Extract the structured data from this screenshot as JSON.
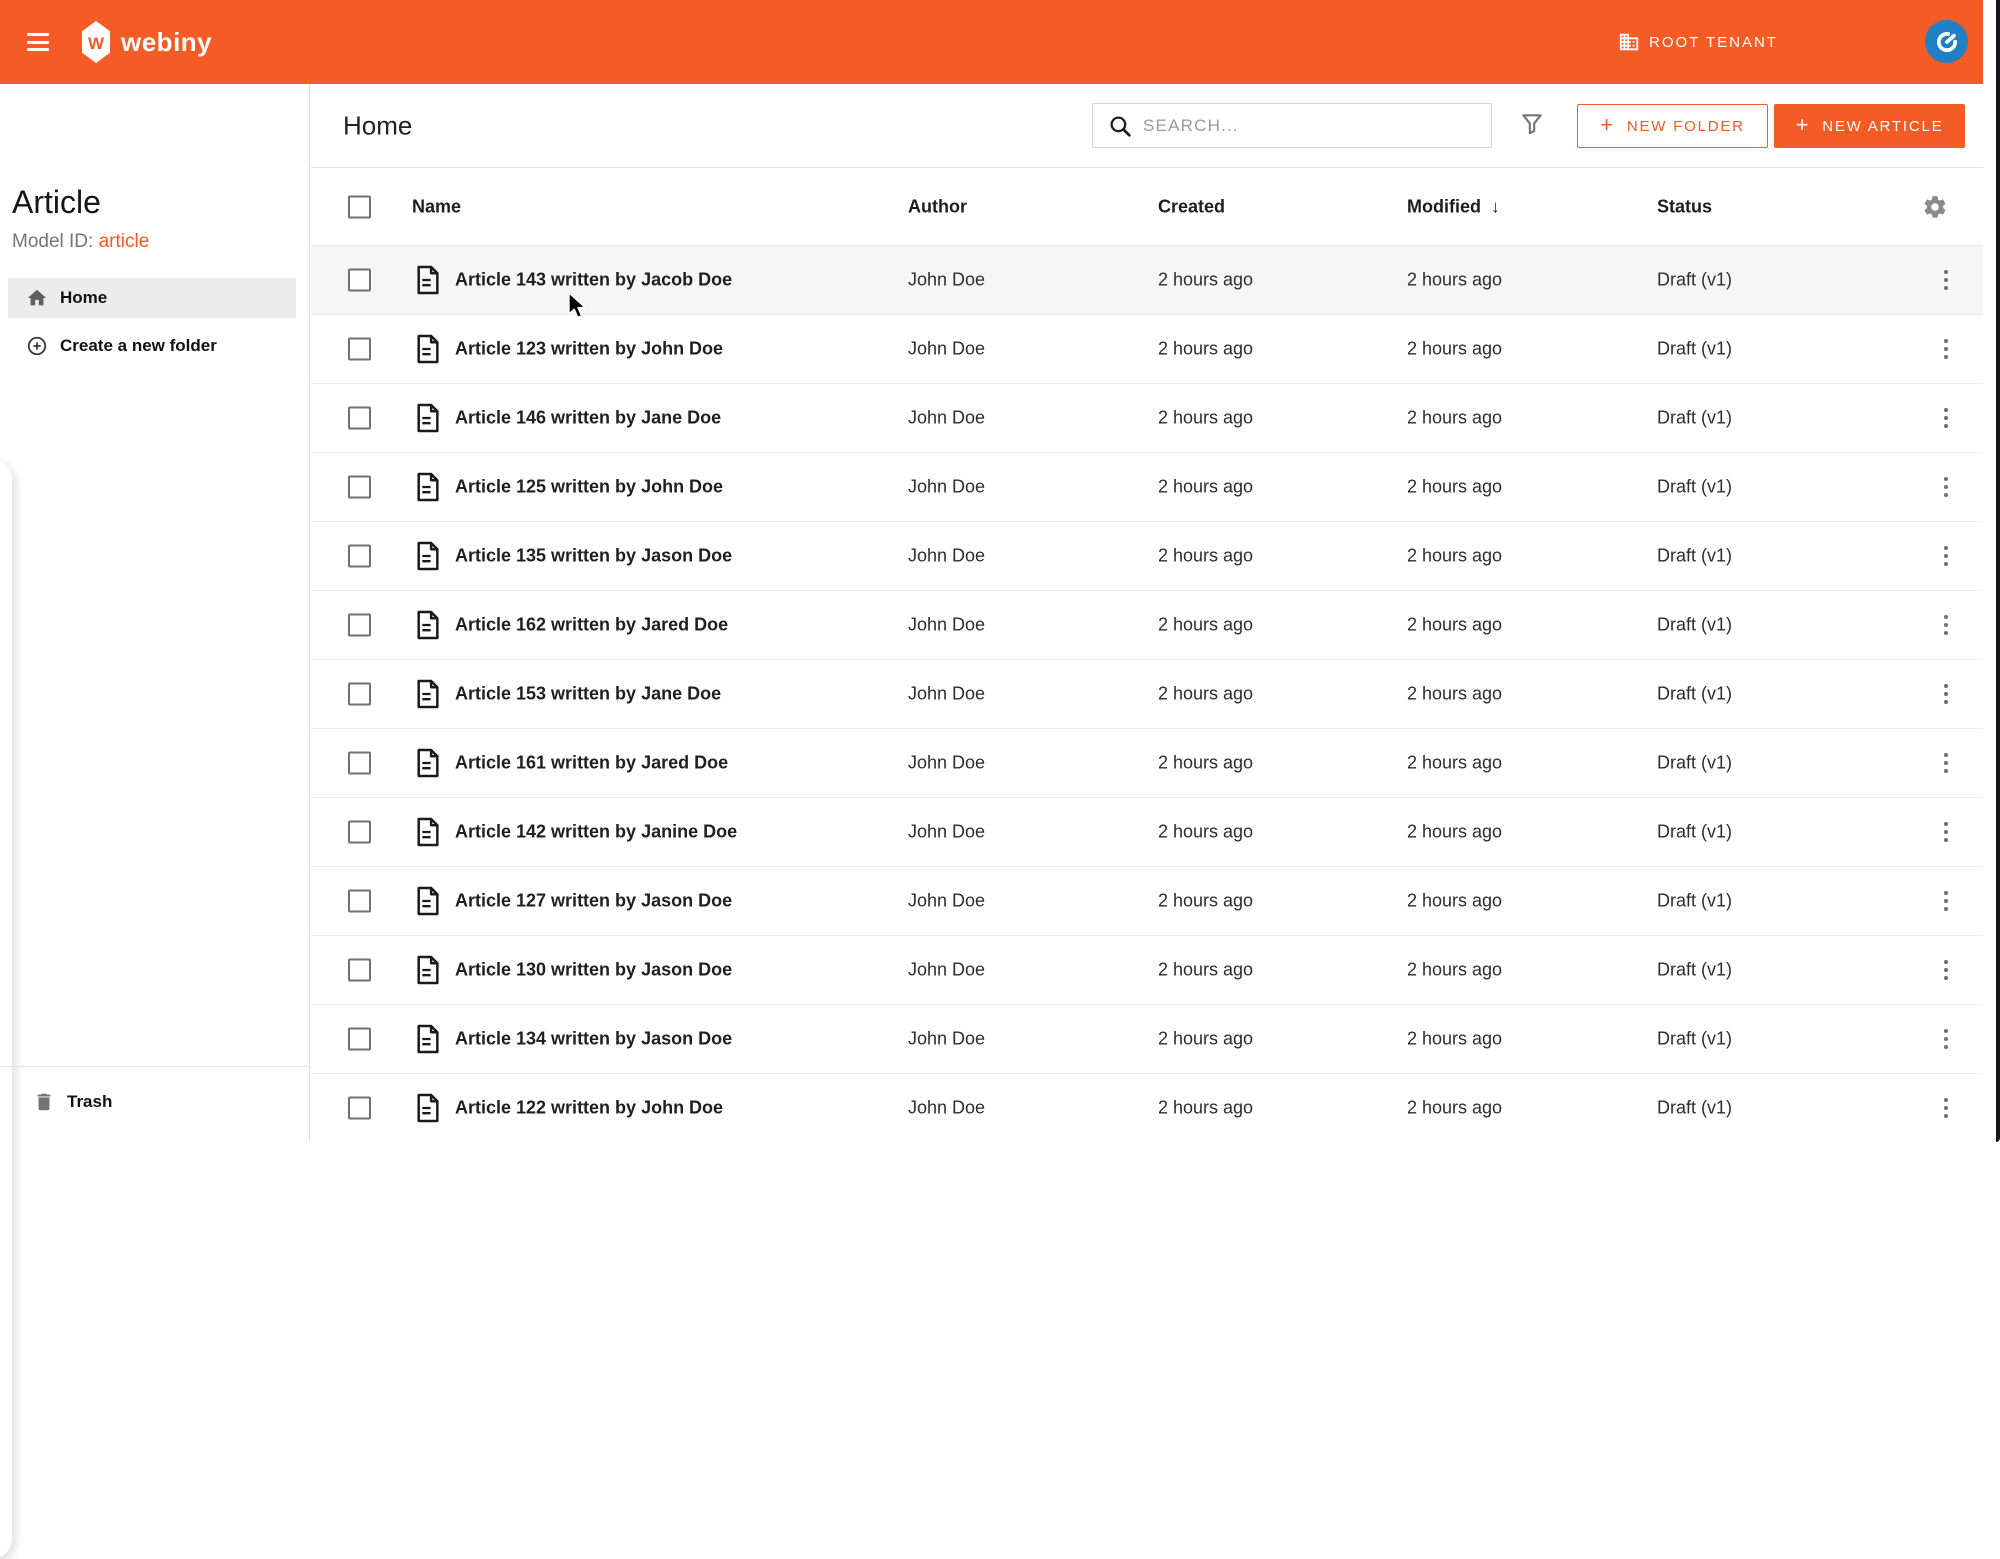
{
  "header": {
    "brand": "webiny",
    "brand_letter": "W",
    "tenant_label": "ROOT TENANT"
  },
  "sidebar": {
    "title": "Article",
    "model_id_label": "Model ID:",
    "model_id_value": "article",
    "home_label": "Home",
    "new_folder_label": "Create a new folder",
    "trash_label": "Trash"
  },
  "toolbar": {
    "breadcrumb": "Home",
    "search_placeholder": "SEARCH...",
    "new_folder_label": "NEW FOLDER",
    "new_article_label": "NEW ARTICLE",
    "plus_char": "+"
  },
  "table": {
    "columns": {
      "name": "Name",
      "author": "Author",
      "created": "Created",
      "modified": "Modified",
      "status": "Status"
    },
    "sort_column": "Modified",
    "sort_icon": "↓",
    "rows": [
      {
        "name": "Article 143 written by Jacob Doe",
        "author": "John Doe",
        "created": "2 hours ago",
        "modified": "2 hours ago",
        "status": "Draft (v1)",
        "hovered": true
      },
      {
        "name": "Article 123 written by John Doe",
        "author": "John Doe",
        "created": "2 hours ago",
        "modified": "2 hours ago",
        "status": "Draft (v1)",
        "hovered": false
      },
      {
        "name": "Article 146 written by Jane Doe",
        "author": "John Doe",
        "created": "2 hours ago",
        "modified": "2 hours ago",
        "status": "Draft (v1)",
        "hovered": false
      },
      {
        "name": "Article 125 written by John Doe",
        "author": "John Doe",
        "created": "2 hours ago",
        "modified": "2 hours ago",
        "status": "Draft (v1)",
        "hovered": false
      },
      {
        "name": "Article 135 written by Jason Doe",
        "author": "John Doe",
        "created": "2 hours ago",
        "modified": "2 hours ago",
        "status": "Draft (v1)",
        "hovered": false
      },
      {
        "name": "Article 162 written by Jared Doe",
        "author": "John Doe",
        "created": "2 hours ago",
        "modified": "2 hours ago",
        "status": "Draft (v1)",
        "hovered": false
      },
      {
        "name": "Article 153 written by Jane Doe",
        "author": "John Doe",
        "created": "2 hours ago",
        "modified": "2 hours ago",
        "status": "Draft (v1)",
        "hovered": false
      },
      {
        "name": "Article 161 written by Jared Doe",
        "author": "John Doe",
        "created": "2 hours ago",
        "modified": "2 hours ago",
        "status": "Draft (v1)",
        "hovered": false
      },
      {
        "name": "Article 142 written by Janine Doe",
        "author": "John Doe",
        "created": "2 hours ago",
        "modified": "2 hours ago",
        "status": "Draft (v1)",
        "hovered": false
      },
      {
        "name": "Article 127 written by Jason Doe",
        "author": "John Doe",
        "created": "2 hours ago",
        "modified": "2 hours ago",
        "status": "Draft (v1)",
        "hovered": false
      },
      {
        "name": "Article 130 written by Jason Doe",
        "author": "John Doe",
        "created": "2 hours ago",
        "modified": "2 hours ago",
        "status": "Draft (v1)",
        "hovered": false
      },
      {
        "name": "Article 134 written by Jason Doe",
        "author": "John Doe",
        "created": "2 hours ago",
        "modified": "2 hours ago",
        "status": "Draft (v1)",
        "hovered": false
      },
      {
        "name": "Article 122 written by John Doe",
        "author": "John Doe",
        "created": "2 hours ago",
        "modified": "2 hours ago",
        "status": "Draft (v1)",
        "hovered": false
      }
    ]
  },
  "colors": {
    "accent_orange": "#f55b24",
    "avatar_blue": "#1f80c4",
    "hover_row": "#f6f6f6",
    "active_item_bg": "#ececec"
  }
}
